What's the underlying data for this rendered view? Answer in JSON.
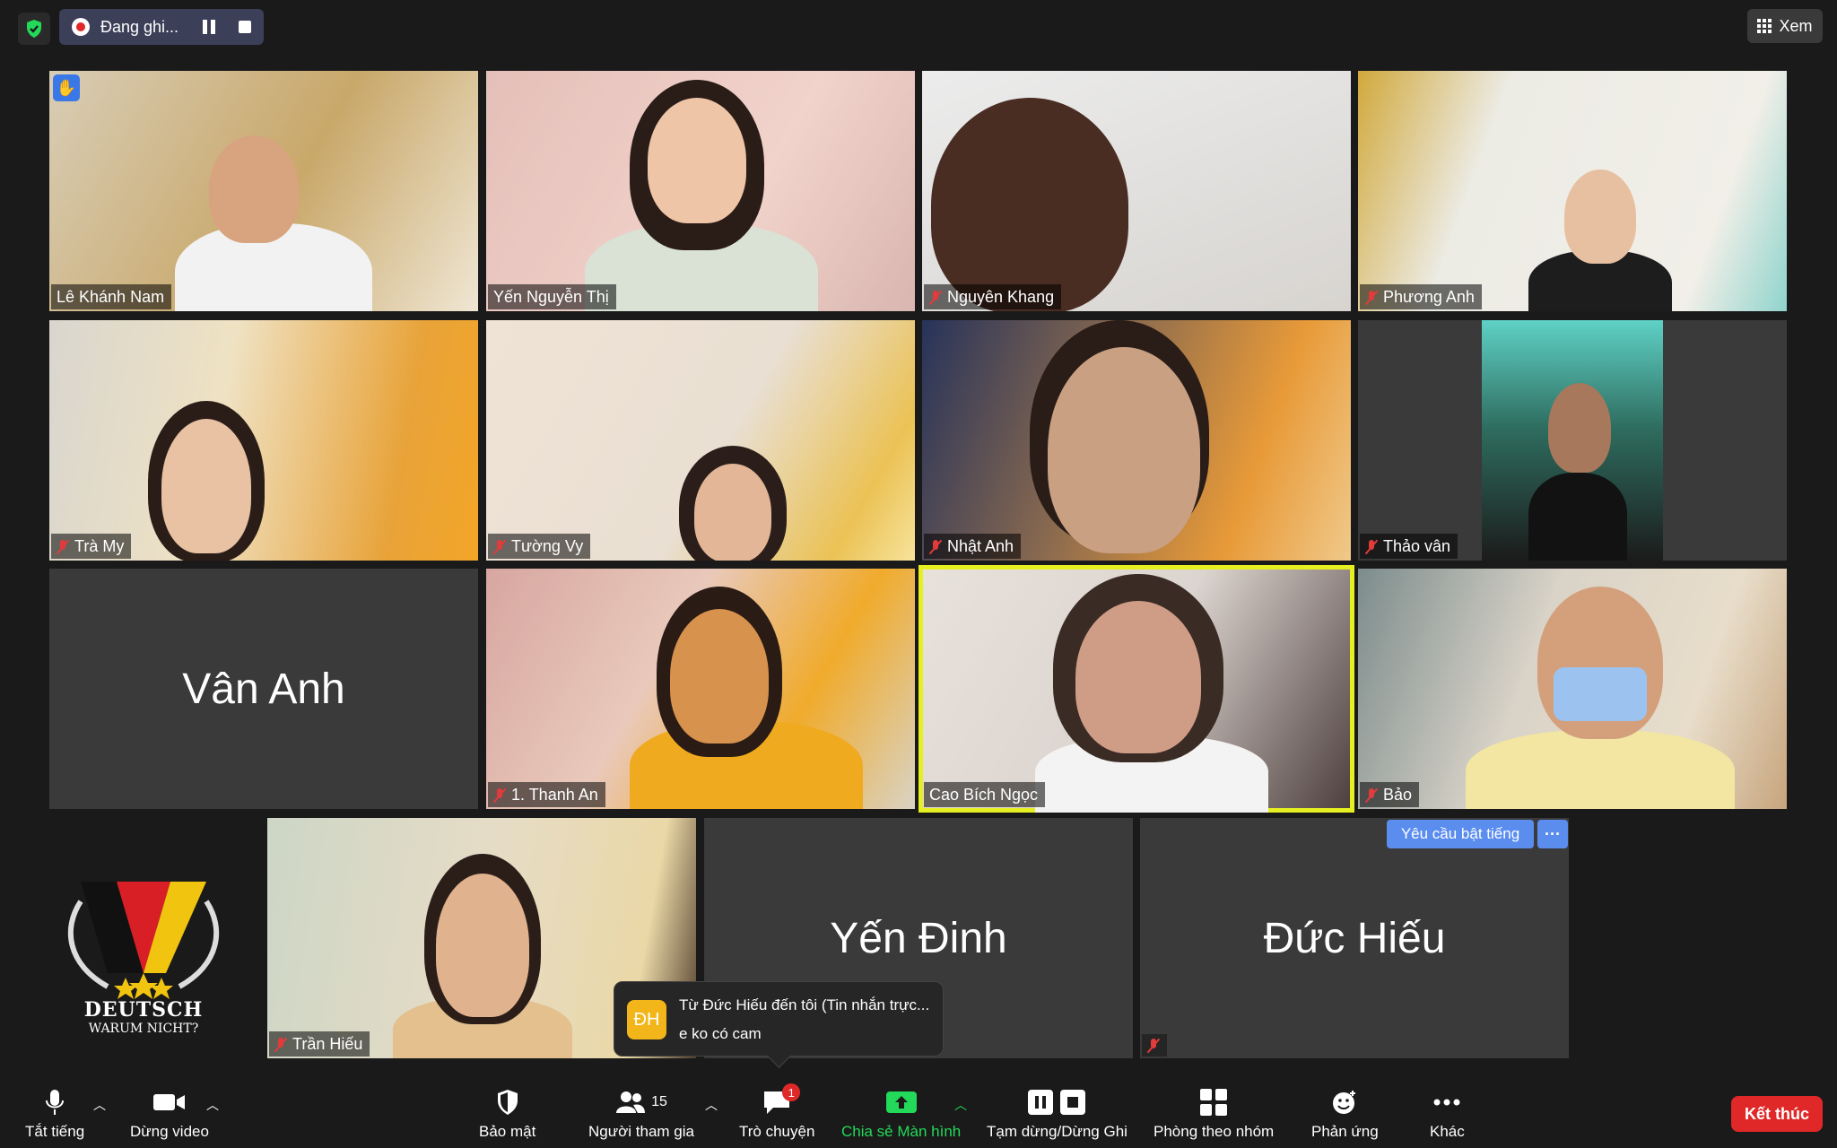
{
  "topbar": {
    "recording_label": "Đang ghi...",
    "view_label": "Xem"
  },
  "tiles": [
    {
      "name": "Lê Khánh Nam",
      "muted": false,
      "raised_hand": true
    },
    {
      "name": "Yến Nguyễn Thị",
      "muted": false
    },
    {
      "name": "Nguyên Khang",
      "muted": true
    },
    {
      "name": "Phương Anh",
      "muted": true
    },
    {
      "name": "Trà My",
      "muted": true
    },
    {
      "name": "Tường Vy",
      "muted": true
    },
    {
      "name": "Nhật Anh",
      "muted": true
    },
    {
      "name": "Thảo vân",
      "muted": true
    },
    {
      "name": "Vân Anh",
      "video": false
    },
    {
      "name": "1. Thanh An",
      "muted": true
    },
    {
      "name": "Cao Bích Ngọc",
      "muted": false,
      "active_speaker": true
    },
    {
      "name": "Bảo",
      "muted": true
    },
    {
      "name": "Trần Hiếu",
      "muted": true
    },
    {
      "name": "Yến Đinh",
      "video": false
    },
    {
      "name": "Đức Hiếu",
      "video": false,
      "muted": true
    }
  ],
  "unmute_request": {
    "label": "Yêu cầu bật tiếng",
    "more": "···"
  },
  "logo": {
    "line1": "DEUTSCH",
    "line2": "WARUM NICHT?"
  },
  "chat_popup": {
    "avatar": "ĐH",
    "from": "Từ Đức Hiếu đến tôi (Tin nhắn trực...",
    "message": "e ko có cam"
  },
  "toolbar": {
    "mute": "Tắt tiếng",
    "video": "Dừng video",
    "security": "Bảo mật",
    "participants": "Người tham gia",
    "participants_count": "15",
    "chat": "Trò chuyện",
    "chat_badge": "1",
    "share": "Chia sẻ Màn hình",
    "record": "Tạm dừng/Dừng Ghi",
    "breakout": "Phòng theo nhóm",
    "reactions": "Phản ứng",
    "more": "Khác",
    "end": "Kết thúc"
  },
  "colors": {
    "active_speaker": "#e6f020",
    "share_green": "#23d959",
    "end_red": "#e02828",
    "mute_red": "#e23b3b",
    "accent_blue": "#5b8def"
  }
}
